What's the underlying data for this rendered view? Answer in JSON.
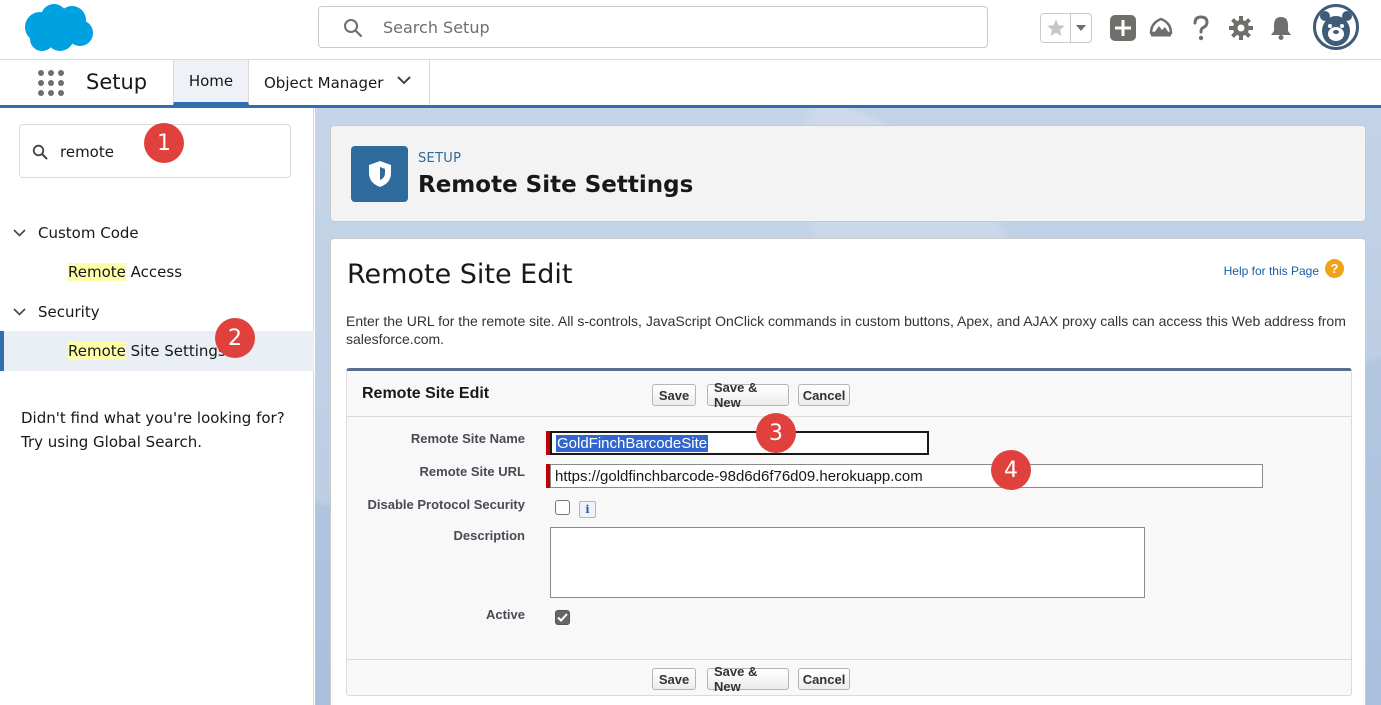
{
  "header": {
    "search_placeholder": "Search Setup"
  },
  "context": {
    "app_name": "Setup",
    "tabs": [
      {
        "label": "Home"
      },
      {
        "label": "Object Manager"
      }
    ]
  },
  "sidebar": {
    "quickfind_value": "remote",
    "groups": [
      {
        "label": "Custom Code",
        "items": [
          {
            "hl": "Remote",
            "rest": " Access"
          }
        ]
      },
      {
        "label": "Security",
        "items": [
          {
            "hl": "Remote",
            "rest": " Site Settings"
          }
        ]
      }
    ],
    "not_found_line1": "Didn't find what you're looking for?",
    "not_found_line2": "Try using Global Search."
  },
  "page_header": {
    "breadcrumb": "SETUP",
    "title": "Remote Site Settings"
  },
  "content": {
    "title": "Remote Site Edit",
    "help_link": "Help for this Page",
    "help_icon_glyph": "?",
    "intro": "Enter the URL for the remote site. All s-controls, JavaScript OnClick commands in custom buttons, Apex, and AJAX proxy calls can access this Web address from salesforce.com."
  },
  "form": {
    "section_title": "Remote Site Edit",
    "buttons": {
      "save": "Save",
      "save_new": "Save & New",
      "cancel": "Cancel"
    },
    "fields": {
      "name_label": "Remote Site Name",
      "name_value": "GoldFinchBarcodeSite",
      "url_label": "Remote Site URL",
      "url_value": "https://goldfinchbarcode-98d6d6f76d09.herokuapp.com",
      "protocol_label": "Disable Protocol Security",
      "protocol_checked": false,
      "description_label": "Description",
      "description_value": "",
      "active_label": "Active",
      "active_checked": true,
      "info_glyph": "i"
    }
  },
  "annotations": [
    "1",
    "2",
    "3",
    "4"
  ],
  "colors": {
    "accent": "#2f6fb0",
    "badge": "#e0413c",
    "highlight": "#fdfdaa",
    "page_icon": "#2e6a9c"
  }
}
